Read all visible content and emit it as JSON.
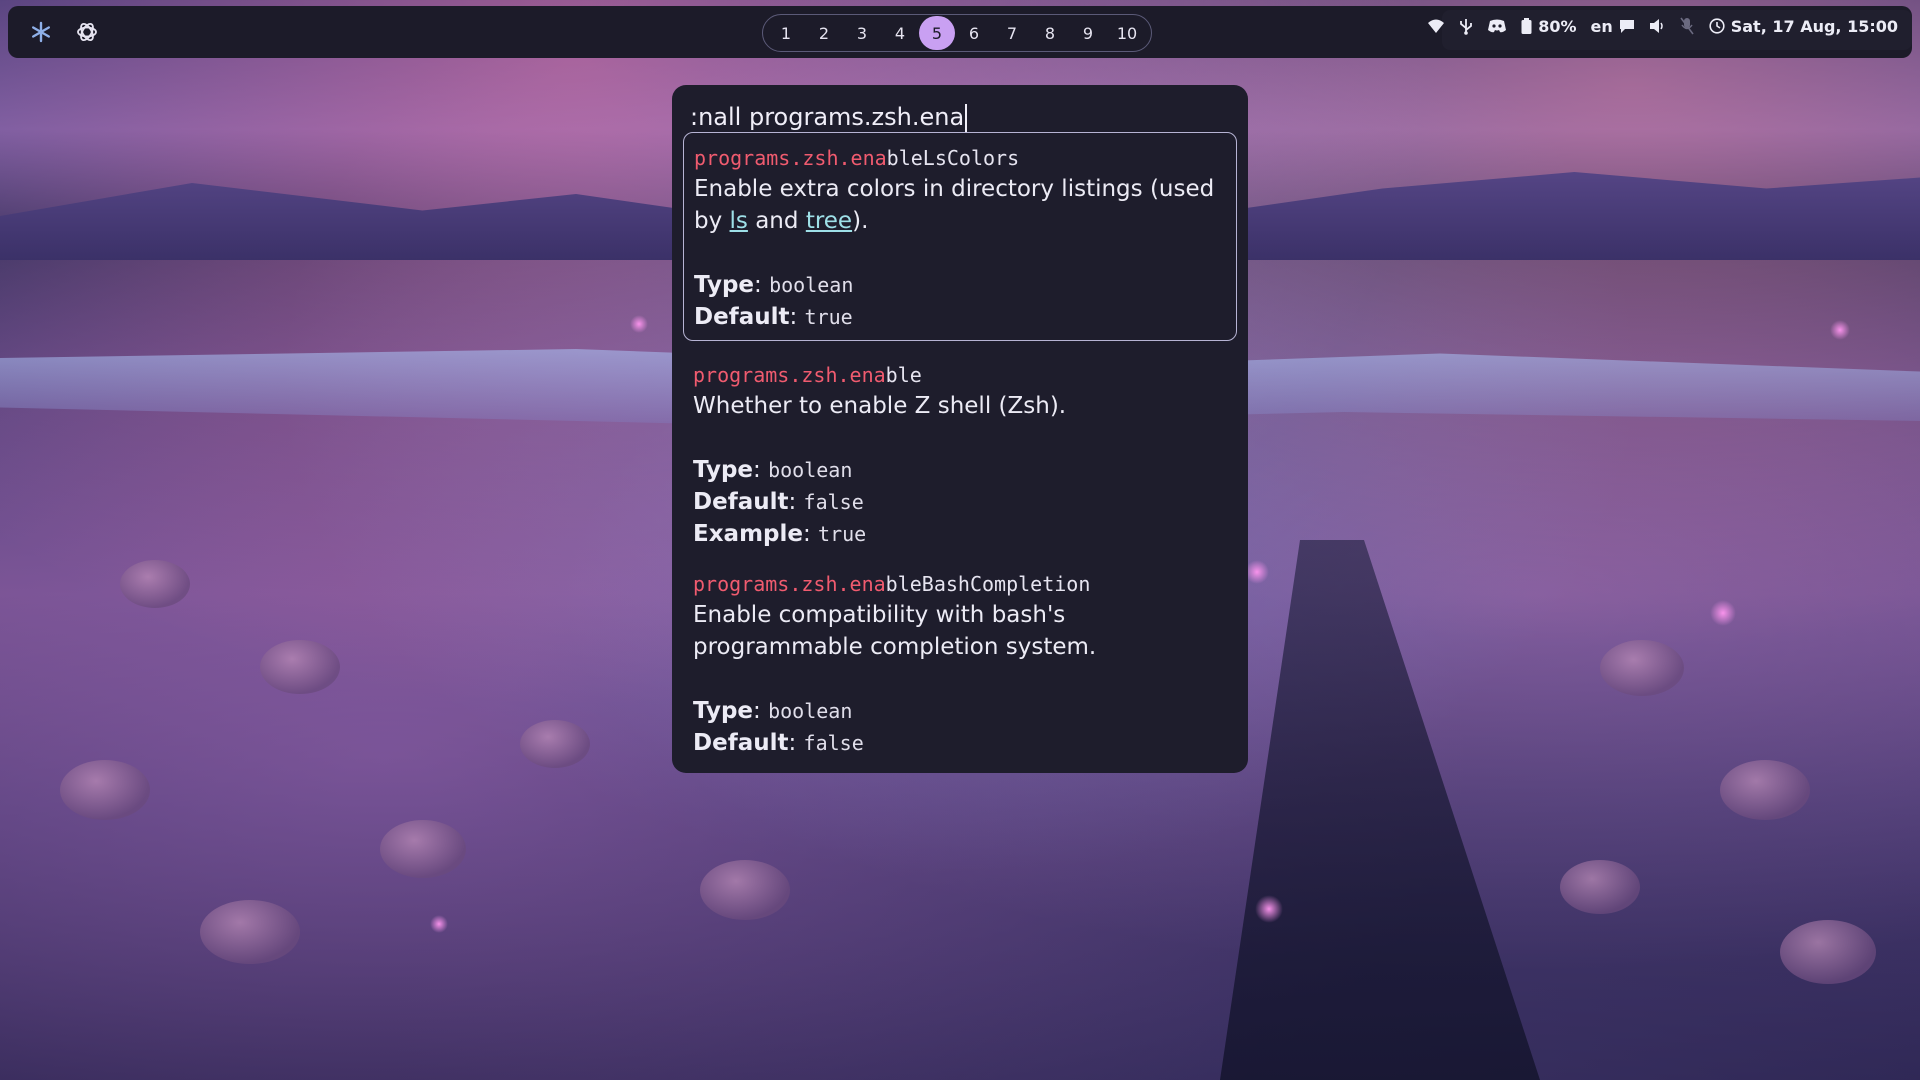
{
  "topbar": {
    "left_icons": [
      "nixos-snowflake-icon",
      "openai-icon"
    ],
    "workspaces": [
      "1",
      "2",
      "3",
      "4",
      "5",
      "6",
      "7",
      "8",
      "9",
      "10"
    ],
    "active_workspace": "5",
    "status": {
      "battery": "80%",
      "language": "en",
      "clock": "Sat, 17 Aug, 15:00"
    },
    "status_icons": [
      "wifi-icon",
      "usb-icon",
      "discord-icon",
      "battery-icon",
      "chat-icon",
      "volume-icon",
      "mic-muted-icon",
      "clock-icon"
    ]
  },
  "launcher": {
    "query": ":nall programs.zsh.ena",
    "results": [
      {
        "match": "programs.zsh.ena",
        "rest": "bleLsColors",
        "desc_before": "Enable extra colors in directory listings (used by ",
        "link1": "ls",
        "desc_mid": " and ",
        "link2": "tree",
        "desc_after": ").",
        "type_label": "Type",
        "type_value": "boolean",
        "default_label": "Default",
        "default_value": "true"
      },
      {
        "match": "programs.zsh.ena",
        "rest": "ble",
        "desc": "Whether to enable Z shell (Zsh).",
        "type_label": "Type",
        "type_value": "boolean",
        "default_label": "Default",
        "default_value": "false",
        "example_label": "Example",
        "example_value": "true"
      },
      {
        "match": "programs.zsh.ena",
        "rest": "bleBashCompletion",
        "desc": "Enable compatibility with bash's programmable completion system.",
        "type_label": "Type",
        "type_value": "boolean",
        "default_label": "Default",
        "default_value": "false"
      }
    ]
  },
  "colors": {
    "bar_bg": "#1c1b29",
    "accent": "#c9a0f2",
    "match_red": "#f05b6f",
    "link_cyan": "#9ee0e8"
  }
}
